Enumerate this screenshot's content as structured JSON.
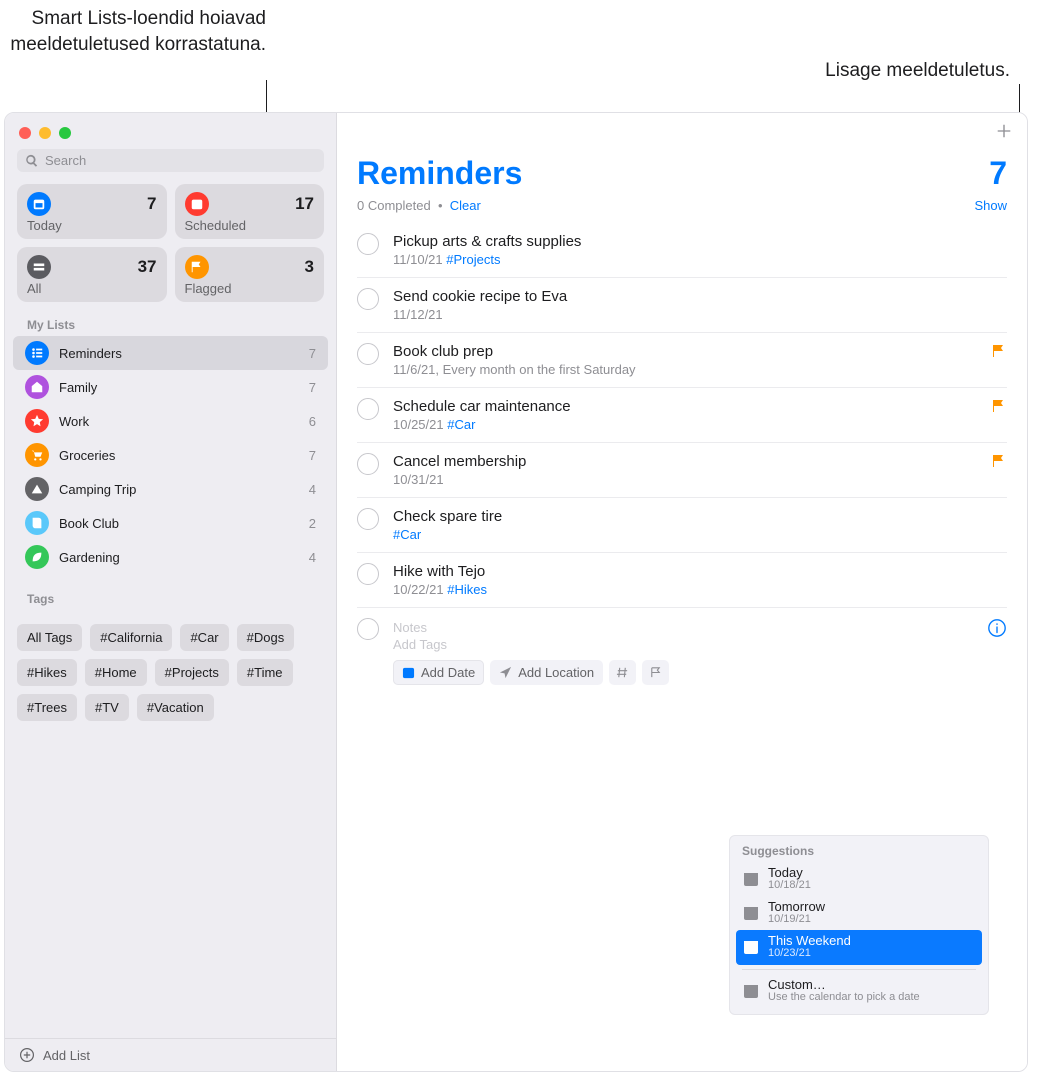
{
  "callouts": {
    "left": "Smart Lists-loendid hoiavad meeldetuletused korrastatuna.",
    "right": "Lisage meeldetuletus."
  },
  "sidebar": {
    "search_placeholder": "Search",
    "smart": [
      {
        "label": "Today",
        "count": "7",
        "icon": "today"
      },
      {
        "label": "Scheduled",
        "count": "17",
        "icon": "sched"
      },
      {
        "label": "All",
        "count": "37",
        "icon": "all"
      },
      {
        "label": "Flagged",
        "count": "3",
        "icon": "flag"
      }
    ],
    "mylists_title": "My Lists",
    "lists": [
      {
        "label": "Reminders",
        "count": "7",
        "color": "#007aff",
        "icon": "list",
        "selected": true
      },
      {
        "label": "Family",
        "count": "7",
        "color": "#af52de",
        "icon": "home",
        "selected": false
      },
      {
        "label": "Work",
        "count": "6",
        "color": "#ff3b30",
        "icon": "star",
        "selected": false
      },
      {
        "label": "Groceries",
        "count": "7",
        "color": "#ff9500",
        "icon": "cart",
        "selected": false
      },
      {
        "label": "Camping Trip",
        "count": "4",
        "color": "#636366",
        "icon": "tent",
        "selected": false
      },
      {
        "label": "Book Club",
        "count": "2",
        "color": "#5ac8fa",
        "icon": "book",
        "selected": false
      },
      {
        "label": "Gardening",
        "count": "4",
        "color": "#34c759",
        "icon": "leaf",
        "selected": false
      }
    ],
    "tags_title": "Tags",
    "tags": [
      "All Tags",
      "#California",
      "#Car",
      "#Dogs",
      "#Hikes",
      "#Home",
      "#Projects",
      "#Time",
      "#Trees",
      "#TV",
      "#Vacation"
    ],
    "add_list": "Add List"
  },
  "main": {
    "title": "Reminders",
    "count": "7",
    "completed": "0 Completed",
    "clear": "Clear",
    "show": "Show",
    "reminders": [
      {
        "title": "Pickup arts & crafts supplies",
        "date": "11/10/21",
        "hash": "#Projects",
        "flagged": false
      },
      {
        "title": "Send cookie recipe to Eva",
        "date": "11/12/21",
        "hash": "",
        "flagged": false
      },
      {
        "title": "Book club prep",
        "date": "11/6/21, Every month on the first Saturday",
        "hash": "",
        "flagged": true
      },
      {
        "title": "Schedule car maintenance",
        "date": "10/25/21",
        "hash": "#Car",
        "flagged": true
      },
      {
        "title": "Cancel membership",
        "date": "10/31/21",
        "hash": "",
        "flagged": true
      },
      {
        "title": "Check spare tire",
        "date": "",
        "hash": "#Car",
        "flagged": false
      },
      {
        "title": "Hike with Tejo",
        "date": "10/22/21",
        "hash": "#Hikes",
        "flagged": false
      }
    ],
    "new_item": {
      "notes_ph": "Notes",
      "tags_ph": "Add Tags",
      "add_date": "Add Date",
      "add_location": "Add Location"
    },
    "suggestions": {
      "title": "Suggestions",
      "items": [
        {
          "label": "Today",
          "date": "10/18/21",
          "selected": false
        },
        {
          "label": "Tomorrow",
          "date": "10/19/21",
          "selected": false
        },
        {
          "label": "This Weekend",
          "date": "10/23/21",
          "selected": true
        },
        {
          "label": "Custom…",
          "date": "Use the calendar to pick a date",
          "selected": false,
          "div_before": true
        }
      ]
    }
  }
}
